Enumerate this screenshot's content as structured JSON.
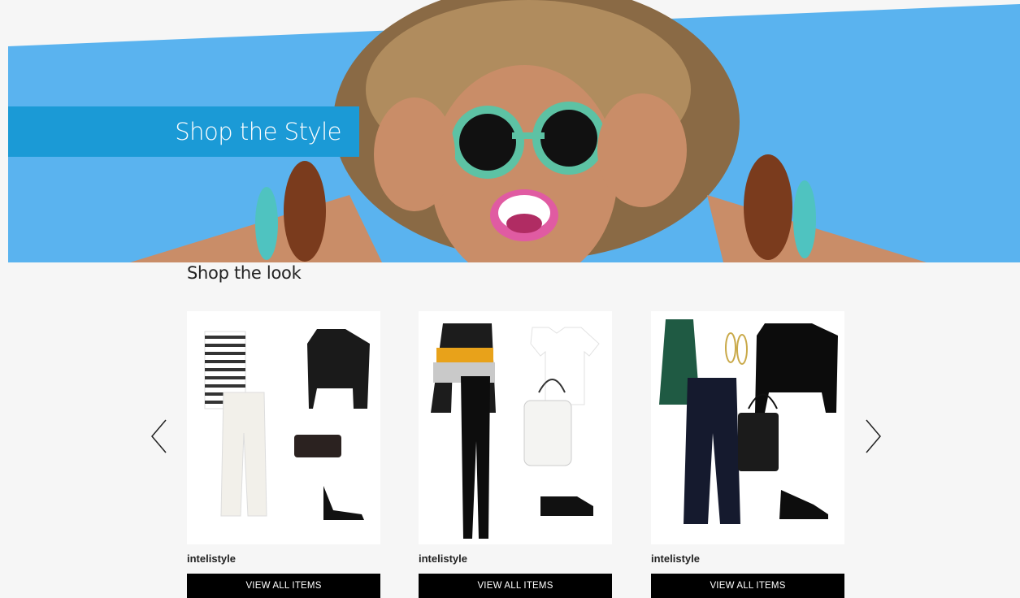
{
  "hero": {
    "title": "Shop the Style",
    "colors": {
      "sky": "#5ab3ef",
      "band": "#1b9ad6"
    }
  },
  "section": {
    "title": "Shop the look"
  },
  "carousel": {
    "prev_icon": "chevron-left-icon",
    "next_icon": "chevron-right-icon",
    "cards": [
      {
        "brand": "intelistyle",
        "button_label": "VIEW ALL ITEMS"
      },
      {
        "brand": "intelistyle",
        "button_label": "VIEW ALL ITEMS"
      },
      {
        "brand": "intelistyle",
        "button_label": "VIEW ALL ITEMS"
      }
    ]
  }
}
